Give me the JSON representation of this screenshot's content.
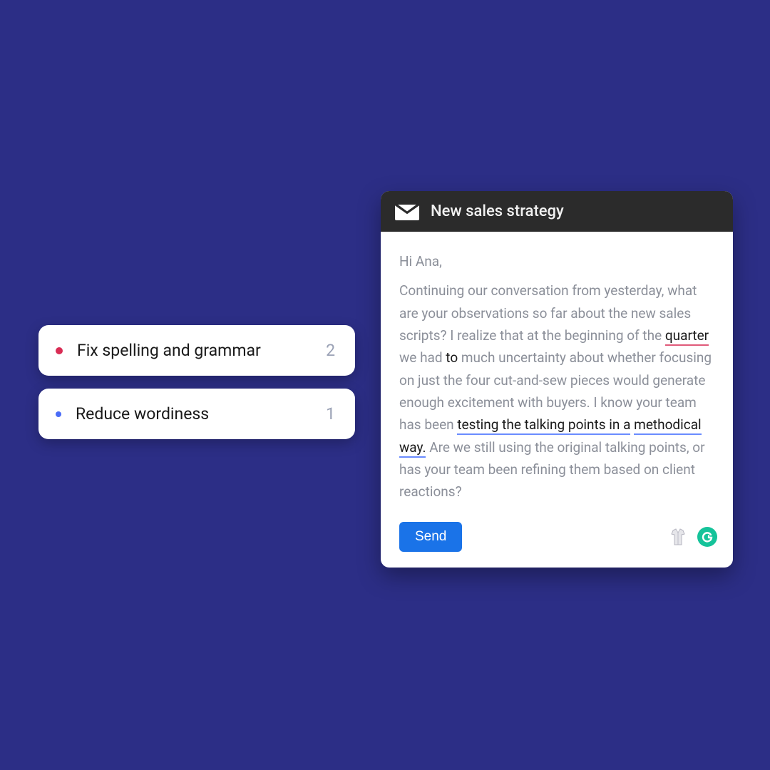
{
  "suggestions": [
    {
      "label": "Fix spelling and grammar",
      "count": "2",
      "color": "red"
    },
    {
      "label": "Reduce wordiness",
      "count": "1",
      "color": "blue"
    }
  ],
  "compose": {
    "title": "New sales strategy",
    "greeting": "Hi Ana,",
    "body_parts": {
      "p1": "Continuing our conversation from yesterday, what are your observations so far about the new sales scripts? I realize that at the beginning of the ",
      "w_quarter": "quarter",
      "p2": " we had ",
      "w_to": "to",
      "p3": " much uncertainty about whether focusing on just the four cut-and-sew pieces would generate enough excitement with buyers. I know your team has been ",
      "w_testing1": "testing the talking points in a",
      "w_testing2": "methodical way.",
      "p4": " Are we still using the original talking points, or has your team been refining them based on client reactions?"
    },
    "send_label": "Send"
  }
}
